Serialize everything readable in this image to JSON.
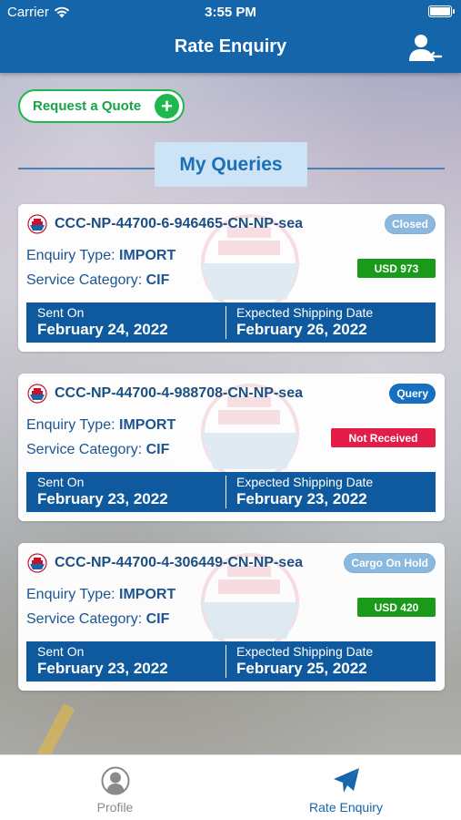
{
  "status_bar": {
    "carrier": "Carrier",
    "time": "3:55 PM"
  },
  "header": {
    "title": "Rate Enquiry",
    "action_icon": "user-switch-icon"
  },
  "request_quote": {
    "label": "Request a Quote",
    "icon": "plus-icon",
    "color": "#1fb84d"
  },
  "queries_heading": "My Queries",
  "labels": {
    "enquiry_type": "Enquiry Type:",
    "service_category": "Service Category:",
    "sent_on": "Sent On",
    "expected_shipping_date": "Expected Shipping Date"
  },
  "queries": [
    {
      "id": "CCC-NP-44700-6-946465-CN-NP-sea",
      "status": "Closed",
      "status_color": "#8bb8df",
      "enquiry_type": "IMPORT",
      "service_category": "CIF",
      "price_label": "USD 973",
      "price_color": "#1a9a1a",
      "sent_on": "February 24, 2022",
      "expected_shipping_date": "February 26, 2022"
    },
    {
      "id": "CCC-NP-44700-4-988708-CN-NP-sea",
      "status": "Query",
      "status_color": "#1670c2",
      "enquiry_type": "IMPORT",
      "service_category": "CIF",
      "price_label": "Not Received",
      "price_color": "#e11d48",
      "sent_on": "February 23, 2022",
      "expected_shipping_date": "February 23, 2022"
    },
    {
      "id": "CCC-NP-44700-4-306449-CN-NP-sea",
      "status": "Cargo On Hold",
      "status_color": "#8bb8df",
      "enquiry_type": "IMPORT",
      "service_category": "CIF",
      "price_label": "USD 420",
      "price_color": "#1a9a1a",
      "sent_on": "February 23, 2022",
      "expected_shipping_date": "February 25, 2022"
    }
  ],
  "tabs": [
    {
      "label": "Profile",
      "icon": "profile-icon",
      "active": false
    },
    {
      "label": "Rate Enquiry",
      "icon": "paper-plane-icon",
      "active": true
    }
  ],
  "colors": {
    "primary": "#1565ab",
    "tab_active": "#1565ab",
    "tab_inactive": "#8a8a8a"
  }
}
